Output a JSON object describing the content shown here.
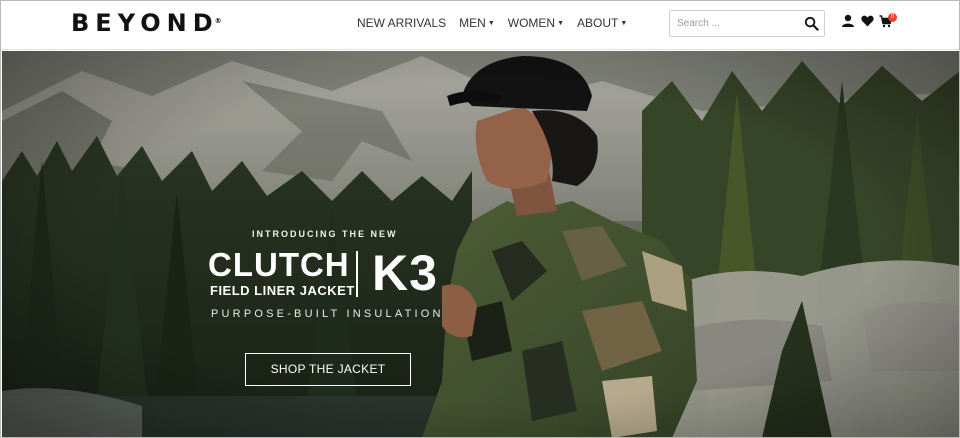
{
  "brand": {
    "name": "BEYOND",
    "registered": "®"
  },
  "nav": [
    {
      "label": "NEW ARRIVALS",
      "dropdown": false
    },
    {
      "label": "MEN",
      "dropdown": true
    },
    {
      "label": "WOMEN",
      "dropdown": true
    },
    {
      "label": "ABOUT",
      "dropdown": true
    }
  ],
  "search": {
    "placeholder": "Search ...",
    "icon": "search-icon"
  },
  "header_icons": {
    "account": "user-icon",
    "wishlist": "heart-icon",
    "cart": "cart-icon",
    "cart_count": "0"
  },
  "hero": {
    "eyebrow": "INTRODUCING THE NEW",
    "title": "CLUTCH",
    "subtitle": "FIELD LINER JACKET",
    "model": "K3",
    "tagline": "PURPOSE-BUILT INSULATION",
    "cta_label": "SHOP THE JACKET"
  },
  "colors": {
    "accent_badge": "#e8442a",
    "header_bg": "#ffffff",
    "text_dark": "#111111"
  }
}
